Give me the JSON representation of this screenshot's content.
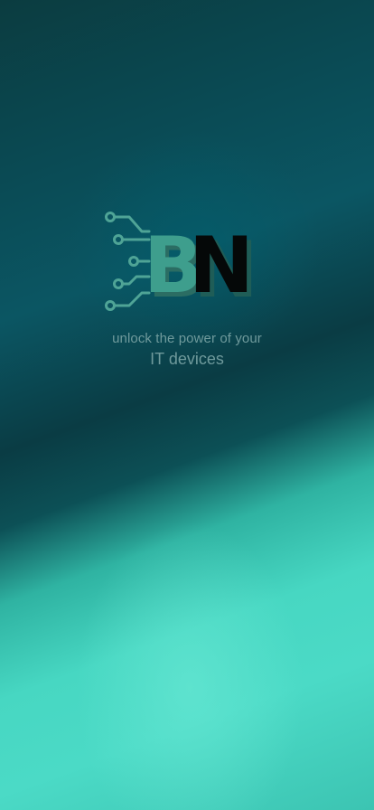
{
  "brand": {
    "logo_text_b": "B",
    "logo_text_n": "N",
    "logo_colors": {
      "b": "#3e9e8d",
      "b_shadow": "#2b6d63",
      "n": "#050808",
      "circuit": "#4fa496"
    }
  },
  "tagline": {
    "line1": "unlock the power of your",
    "line2": "IT devices"
  },
  "icons": [
    "circuit-icon"
  ]
}
